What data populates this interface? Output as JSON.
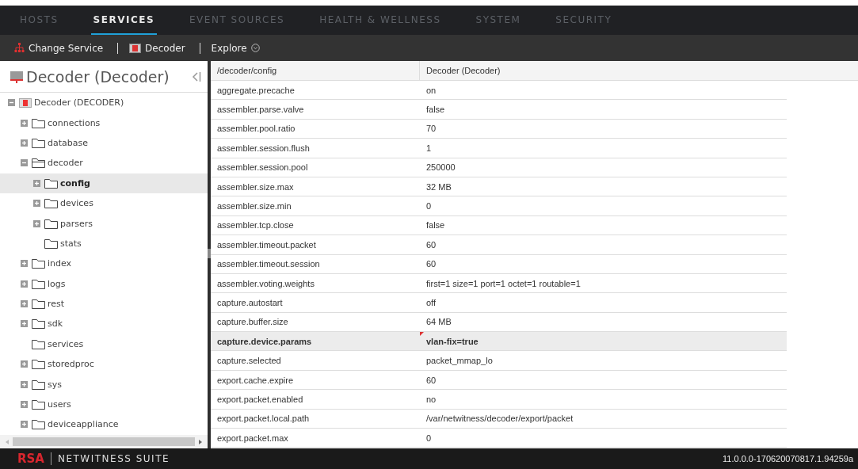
{
  "nav_tabs": [
    {
      "label": "HOSTS",
      "selected": false
    },
    {
      "label": "SERVICES",
      "selected": true
    },
    {
      "label": "EVENT SOURCES",
      "selected": false
    },
    {
      "label": "HEALTH & WELLNESS",
      "selected": false
    },
    {
      "label": "SYSTEM",
      "selected": false
    },
    {
      "label": "SECURITY",
      "selected": false
    }
  ],
  "toolbar": {
    "change_service": "Change Service",
    "service": "Decoder",
    "explore": "Explore"
  },
  "sidebar": {
    "title": "Decoder (Decoder)",
    "tree": {
      "label": "Decoder (DECODER)",
      "kind": "service",
      "expanded": true,
      "selected": false,
      "children": [
        {
          "label": "connections",
          "kind": "folder",
          "expanded": false,
          "selected": false
        },
        {
          "label": "database",
          "kind": "folder",
          "expanded": false,
          "selected": false
        },
        {
          "label": "decoder",
          "kind": "folder",
          "expanded": true,
          "selected": false,
          "children": [
            {
              "label": "config",
              "kind": "folder",
              "expanded": false,
              "selected": true
            },
            {
              "label": "devices",
              "kind": "folder",
              "expanded": false,
              "selected": false
            },
            {
              "label": "parsers",
              "kind": "folder",
              "expanded": false,
              "selected": false
            },
            {
              "label": "stats",
              "kind": "folder",
              "selected": false
            }
          ]
        },
        {
          "label": "index",
          "kind": "folder",
          "expanded": false,
          "selected": false
        },
        {
          "label": "logs",
          "kind": "folder",
          "expanded": false,
          "selected": false
        },
        {
          "label": "rest",
          "kind": "folder",
          "expanded": false,
          "selected": false
        },
        {
          "label": "sdk",
          "kind": "folder",
          "expanded": false,
          "selected": false
        },
        {
          "label": "services",
          "kind": "folder",
          "selected": false
        },
        {
          "label": "storedproc",
          "kind": "folder",
          "expanded": false,
          "selected": false
        },
        {
          "label": "sys",
          "kind": "folder",
          "expanded": false,
          "selected": false
        },
        {
          "label": "users",
          "kind": "folder",
          "expanded": false,
          "selected": false
        },
        {
          "label": "deviceappliance",
          "kind": "folder",
          "expanded": false,
          "selected": false
        }
      ]
    }
  },
  "table": {
    "columns": [
      "/decoder/config",
      "Decoder (Decoder)"
    ],
    "rows": [
      {
        "name": "aggregate.precache",
        "value": "on",
        "selected": false,
        "modified": false
      },
      {
        "name": "assembler.parse.valve",
        "value": "false",
        "selected": false,
        "modified": false
      },
      {
        "name": "assembler.pool.ratio",
        "value": "70",
        "selected": false,
        "modified": false
      },
      {
        "name": "assembler.session.flush",
        "value": "1",
        "selected": false,
        "modified": false
      },
      {
        "name": "assembler.session.pool",
        "value": "250000",
        "selected": false,
        "modified": false
      },
      {
        "name": "assembler.size.max",
        "value": "32 MB",
        "selected": false,
        "modified": false
      },
      {
        "name": "assembler.size.min",
        "value": "0",
        "selected": false,
        "modified": false
      },
      {
        "name": "assembler.tcp.close",
        "value": "false",
        "selected": false,
        "modified": false
      },
      {
        "name": "assembler.timeout.packet",
        "value": "60",
        "selected": false,
        "modified": false
      },
      {
        "name": "assembler.timeout.session",
        "value": "60",
        "selected": false,
        "modified": false
      },
      {
        "name": "assembler.voting.weights",
        "value": "first=1 size=1 port=1 octet=1 routable=1",
        "selected": false,
        "modified": false
      },
      {
        "name": "capture.autostart",
        "value": "off",
        "selected": false,
        "modified": false
      },
      {
        "name": "capture.buffer.size",
        "value": "64 MB",
        "selected": false,
        "modified": false
      },
      {
        "name": "capture.device.params",
        "value": "vlan-fix=true",
        "selected": true,
        "modified": true
      },
      {
        "name": "capture.selected",
        "value": "packet_mmap_lo",
        "selected": false,
        "modified": false
      },
      {
        "name": "export.cache.expire",
        "value": "60",
        "selected": false,
        "modified": false
      },
      {
        "name": "export.packet.enabled",
        "value": "no",
        "selected": false,
        "modified": false
      },
      {
        "name": "export.packet.local.path",
        "value": "/var/netwitness/decoder/export/packet",
        "selected": false,
        "modified": false
      },
      {
        "name": "export.packet.max",
        "value": "0",
        "selected": false,
        "modified": false
      }
    ]
  },
  "footer": {
    "brand": "RSA",
    "product": "NETWITNESS SUITE",
    "version": "11.0.0.0-170620070817.1.94259a"
  }
}
